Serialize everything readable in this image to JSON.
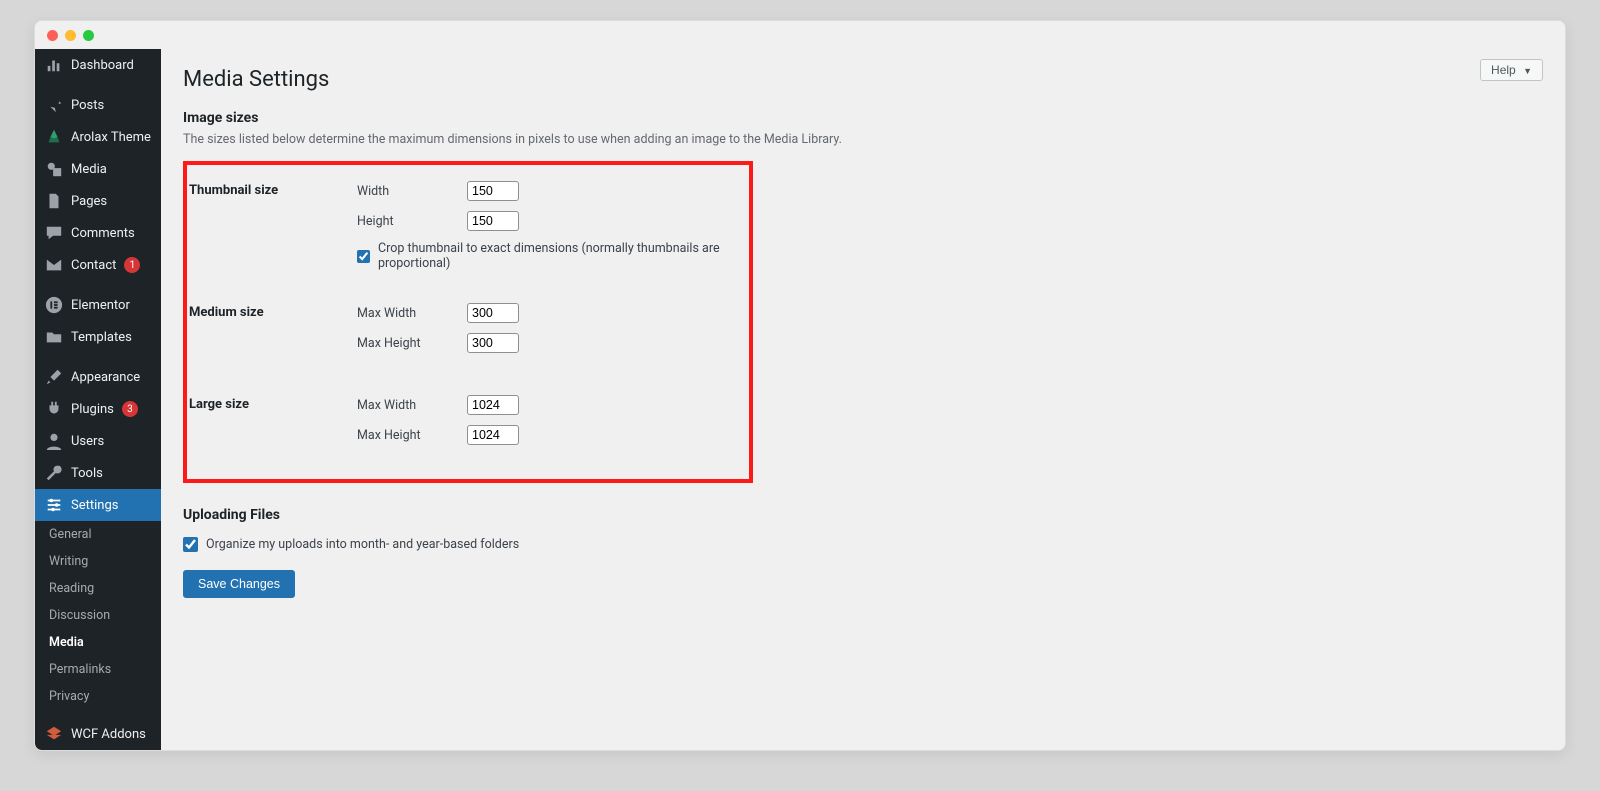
{
  "help_label": "Help",
  "page_title": "Media Settings",
  "sidebar": {
    "items": [
      {
        "label": "Dashboard"
      },
      {
        "label": "Posts"
      },
      {
        "label": "Arolax Theme"
      },
      {
        "label": "Media"
      },
      {
        "label": "Pages"
      },
      {
        "label": "Comments"
      },
      {
        "label": "Contact",
        "badge": "1"
      },
      {
        "label": "Elementor"
      },
      {
        "label": "Templates"
      },
      {
        "label": "Appearance"
      },
      {
        "label": "Plugins",
        "badge": "3"
      },
      {
        "label": "Users"
      },
      {
        "label": "Tools"
      },
      {
        "label": "Settings"
      },
      {
        "label": "WCF Addons"
      }
    ],
    "sub": {
      "general": "General",
      "writing": "Writing",
      "reading": "Reading",
      "discussion": "Discussion",
      "media": "Media",
      "permalinks": "Permalinks",
      "privacy": "Privacy"
    }
  },
  "image_sizes": {
    "heading": "Image sizes",
    "desc": "The sizes listed below determine the maximum dimensions in pixels to use when adding an image to the Media Library.",
    "thumbnail": {
      "label": "Thumbnail size",
      "width_label": "Width",
      "height_label": "Height",
      "width": "150",
      "height": "150",
      "crop_label": "Crop thumbnail to exact dimensions (normally thumbnails are proportional)",
      "crop_checked": true
    },
    "medium": {
      "label": "Medium size",
      "max_w_label": "Max Width",
      "max_h_label": "Max Height",
      "max_w": "300",
      "max_h": "300"
    },
    "large": {
      "label": "Large size",
      "max_w_label": "Max Width",
      "max_h_label": "Max Height",
      "max_w": "1024",
      "max_h": "1024"
    }
  },
  "uploads": {
    "heading": "Uploading Files",
    "organize_label": "Organize my uploads into month- and year-based folders",
    "organize_checked": true
  },
  "save_label": "Save Changes"
}
